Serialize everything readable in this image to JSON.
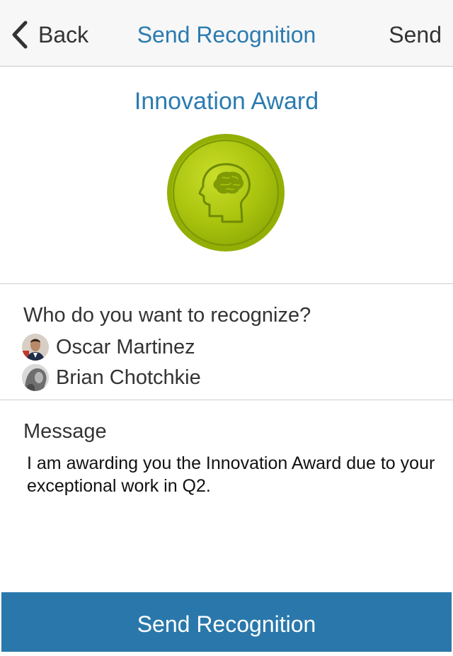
{
  "nav": {
    "back_label": "Back",
    "title": "Send Recognition",
    "send_label": "Send"
  },
  "award": {
    "title": "Innovation Award",
    "icon": "head-brain-icon",
    "badge_color": "#a9c40a"
  },
  "recipients": {
    "label": "Who do you want to recognize?",
    "items": [
      {
        "name": "Oscar Martinez"
      },
      {
        "name": "Brian Chotchkie"
      }
    ]
  },
  "message": {
    "label": "Message",
    "text": "I am awarding you the Innovation Award due to your exceptional work in Q2."
  },
  "footer": {
    "send_button_label": "Send Recognition"
  },
  "colors": {
    "accent": "#2a7bb0",
    "button": "#2a78ab"
  }
}
